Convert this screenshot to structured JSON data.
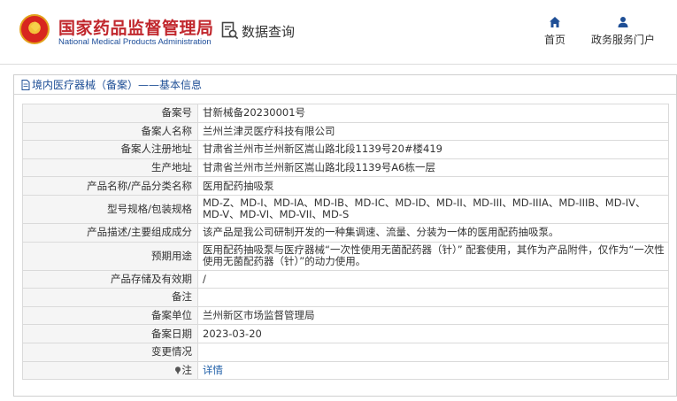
{
  "header": {
    "title": "国家药品监督管理局",
    "subtitle": "National Medical Products Administration",
    "query_label": "数据查询",
    "nav_home": "首页",
    "nav_portal": "政务服务门户"
  },
  "panel": {
    "breadcrumb": "境内医疗器械（备案）——基本信息"
  },
  "rows": [
    {
      "key": "备案号",
      "value": "甘新械备20230001号"
    },
    {
      "key": "备案人名称",
      "value": "兰州兰津灵医疗科技有限公司"
    },
    {
      "key": "备案人注册地址",
      "value": "甘肃省兰州市兰州新区嵩山路北段1139号20#楼419"
    },
    {
      "key": "生产地址",
      "value": "甘肃省兰州市兰州新区嵩山路北段1139号A6栋一层"
    },
    {
      "key": "产品名称/产品分类名称",
      "value": "医用配药抽吸泵"
    },
    {
      "key": "型号规格/包装规格",
      "value": "MD-Z、MD-I、MD-IA、MD-IB、MD-IC、MD-ID、MD-II、MD-III、MD-IIIA、MD-IIIB、MD-IV、MD-V、MD-VI、MD-VII、MD-S"
    },
    {
      "key": "产品描述/主要组成成分",
      "value": "该产品是我公司研制开发的一种集调速、流量、分装为一体的医用配药抽吸泵。"
    },
    {
      "key": "预期用途",
      "value": "医用配药抽吸泵与医疗器械“一次性使用无菌配药器（针）” 配套使用，其作为产品附件，仅作为“一次性使用无菌配药器（针）”的动力使用。"
    },
    {
      "key": "产品存储及有效期",
      "value": "/"
    },
    {
      "key": "备注",
      "value": ""
    },
    {
      "key": "备案单位",
      "value": "兰州新区市场监督管理局"
    },
    {
      "key": "备案日期",
      "value": "2023-03-20"
    },
    {
      "key": "变更情况",
      "value": ""
    },
    {
      "key": "注",
      "value": "详情"
    }
  ],
  "colors": {
    "brand_red": "#c1272d",
    "link_blue": "#1f5fa8"
  }
}
